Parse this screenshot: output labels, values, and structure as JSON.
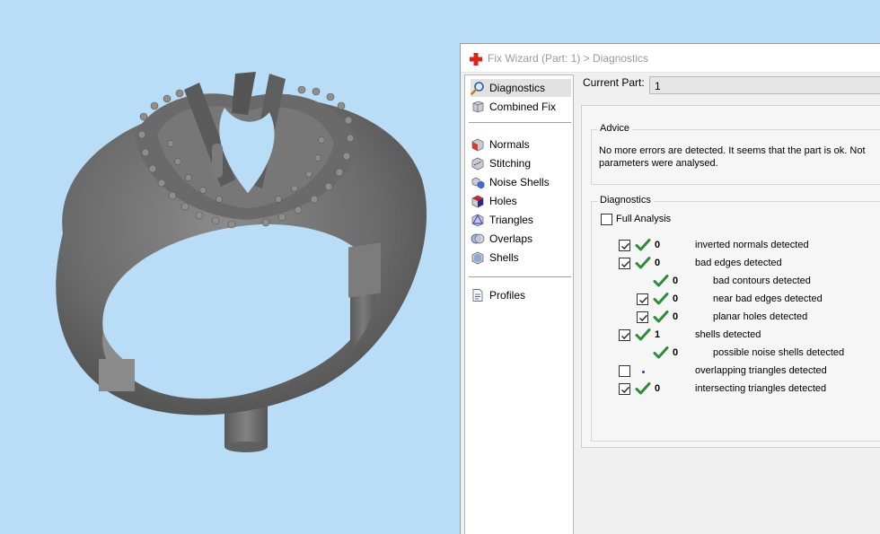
{
  "window": {
    "title": "Fix Wizard (Part: 1) > Diagnostics"
  },
  "nav": {
    "items": [
      {
        "label": "Diagnostics",
        "icon": "magnifier-icon"
      },
      {
        "label": "Combined Fix",
        "icon": "combined-fix-icon"
      },
      {
        "label": "Normals",
        "icon": "cube-normals-icon"
      },
      {
        "label": "Stitching",
        "icon": "stitching-icon"
      },
      {
        "label": "Noise Shells",
        "icon": "noise-shells-icon"
      },
      {
        "label": "Holes",
        "icon": "holes-icon"
      },
      {
        "label": "Triangles",
        "icon": "triangles-icon"
      },
      {
        "label": "Overlaps",
        "icon": "overlaps-icon"
      },
      {
        "label": "Shells",
        "icon": "shells-icon"
      },
      {
        "label": "Profiles",
        "icon": "profiles-icon"
      }
    ],
    "selected": "Diagnostics"
  },
  "current_part": {
    "label": "Current Part:",
    "value": "1"
  },
  "advice": {
    "title": "Advice",
    "line1": "No more errors are detected. It seems that the part is ok. Not",
    "line2": "parameters were analysed."
  },
  "diagnostics": {
    "title": "Diagnostics",
    "full_analysis_label": "Full Analysis",
    "rows": [
      {
        "checked": true,
        "status": "ok",
        "count": "0",
        "label": "inverted normals detected"
      },
      {
        "checked": true,
        "status": "ok",
        "count": "0",
        "label": "bad edges detected"
      },
      {
        "checked": null,
        "status": "ok",
        "count": "0",
        "label": "bad contours detected"
      },
      {
        "checked": true,
        "status": "ok",
        "count": "0",
        "label": "near bad edges detected"
      },
      {
        "checked": true,
        "status": "ok",
        "count": "0",
        "label": "planar holes detected"
      },
      {
        "checked": true,
        "status": "ok",
        "count": "1",
        "label": "shells detected"
      },
      {
        "checked": null,
        "status": "ok",
        "count": "0",
        "label": "possible noise shells detected"
      },
      {
        "checked": false,
        "status": "not-run",
        "count": "",
        "label": "overlapping triangles detected"
      },
      {
        "checked": true,
        "status": "ok",
        "count": "0",
        "label": "intersecting triangles detected"
      }
    ]
  },
  "colors": {
    "viewport_background": "#b9ddf7",
    "model_gray": "#6e6e6e",
    "ok_tick": "#2e8b3a",
    "title_cross": "#d9261c"
  }
}
